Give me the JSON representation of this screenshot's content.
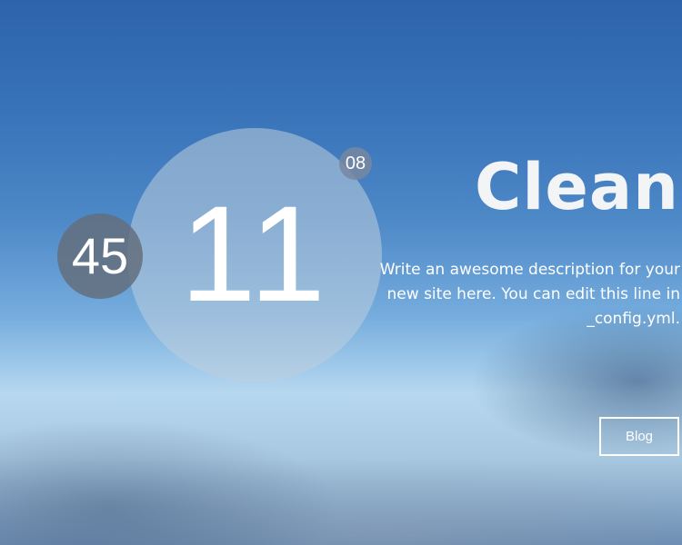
{
  "clock": {
    "hour": "11",
    "minute": "45",
    "second": "08"
  },
  "header": {
    "site_title": "Clean",
    "description": "Write an awesome description for your new site here. You can edit this line in _config.yml."
  },
  "nav": {
    "blog_label": "Blog"
  }
}
